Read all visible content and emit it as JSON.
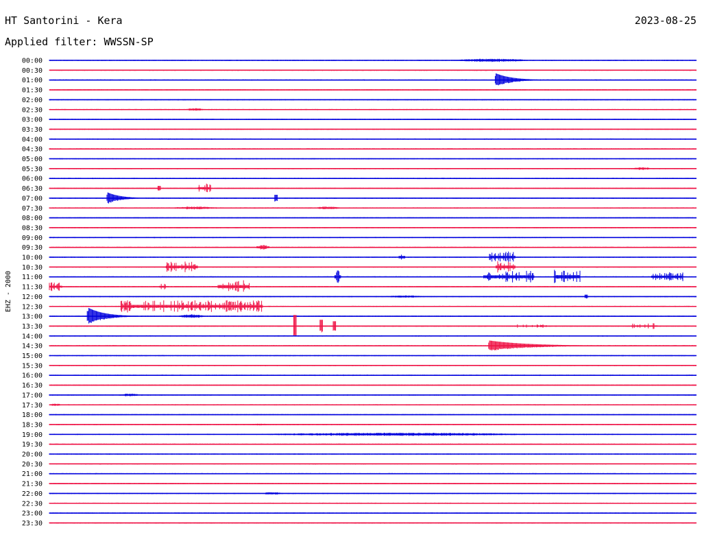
{
  "header": {
    "station": "HT Santorini - Kera",
    "date": "2023-08-25",
    "filter": "Applied filter: WWSSN-SP"
  },
  "chart_data": {
    "type": "line",
    "kind": "helicorder",
    "channel_label": "EHZ - 2000",
    "colors": {
      "odd_rows": "#0000dd",
      "even_rows": "#ee1144"
    },
    "rows": [
      "00:00",
      "00:30",
      "01:00",
      "01:30",
      "02:00",
      "02:30",
      "03:00",
      "03:30",
      "04:00",
      "04:30",
      "05:00",
      "05:30",
      "06:00",
      "06:30",
      "07:00",
      "07:30",
      "08:00",
      "08:30",
      "09:00",
      "09:30",
      "10:00",
      "10:30",
      "11:00",
      "11:30",
      "12:00",
      "12:30",
      "13:00",
      "13:30",
      "14:00",
      "14:30",
      "15:00",
      "15:30",
      "16:00",
      "16:30",
      "17:00",
      "17:30",
      "18:00",
      "18:30",
      "19:00",
      "19:30",
      "20:00",
      "20:30",
      "21:00",
      "21:30",
      "22:00",
      "22:30",
      "23:00",
      "23:30"
    ],
    "events": [
      {
        "row": 0,
        "t": 0.63,
        "amp": 0.35,
        "dur": 0.11,
        "kind": "burst"
      },
      {
        "row": 2,
        "t": 0.69,
        "amp": 1.4,
        "dur": 0.025,
        "kind": "quake"
      },
      {
        "row": 5,
        "t": 0.21,
        "amp": 0.3,
        "dur": 0.03,
        "kind": "burst"
      },
      {
        "row": 11,
        "t": 0.9,
        "amp": 0.3,
        "dur": 0.03,
        "kind": "burst"
      },
      {
        "row": 13,
        "t": 0.17,
        "amp": 0.5,
        "dur": 0.003,
        "kind": "spike"
      },
      {
        "row": 13,
        "t": 0.23,
        "amp": 1.0,
        "dur": 0.02,
        "kind": "cluster"
      },
      {
        "row": 14,
        "t": 0.09,
        "amp": 1.2,
        "dur": 0.02,
        "kind": "quake"
      },
      {
        "row": 14,
        "t": 0.35,
        "amp": 0.7,
        "dur": 0.003,
        "kind": "spike"
      },
      {
        "row": 15,
        "t": 0.19,
        "amp": 0.3,
        "dur": 0.07,
        "kind": "burst"
      },
      {
        "row": 15,
        "t": 0.41,
        "amp": 0.3,
        "dur": 0.04,
        "kind": "burst"
      },
      {
        "row": 19,
        "t": 0.32,
        "amp": 0.5,
        "dur": 0.02,
        "kind": "burst"
      },
      {
        "row": 20,
        "t": 0.54,
        "amp": 1.1,
        "dur": 0.01,
        "kind": "cluster"
      },
      {
        "row": 20,
        "t": 0.68,
        "amp": 1.2,
        "dur": 0.04,
        "kind": "cluster"
      },
      {
        "row": 21,
        "t": 0.18,
        "amp": 1.2,
        "dur": 0.05,
        "kind": "cluster"
      },
      {
        "row": 21,
        "t": 0.69,
        "amp": 1.3,
        "dur": 0.03,
        "kind": "cluster"
      },
      {
        "row": 22,
        "t": 0.44,
        "amp": 1.4,
        "dur": 0.01,
        "kind": "cluster"
      },
      {
        "row": 22,
        "t": 0.67,
        "amp": 1.3,
        "dur": 0.08,
        "kind": "cluster"
      },
      {
        "row": 22,
        "t": 0.78,
        "amp": 1.5,
        "dur": 0.04,
        "kind": "cluster"
      },
      {
        "row": 22,
        "t": 0.93,
        "amp": 1.0,
        "dur": 0.05,
        "kind": "cluster"
      },
      {
        "row": 23,
        "t": 0.0,
        "amp": 0.9,
        "dur": 0.02,
        "kind": "cluster"
      },
      {
        "row": 23,
        "t": 0.17,
        "amp": 0.8,
        "dur": 0.01,
        "kind": "cluster"
      },
      {
        "row": 23,
        "t": 0.26,
        "amp": 1.4,
        "dur": 0.05,
        "kind": "cluster"
      },
      {
        "row": 24,
        "t": 0.52,
        "amp": 0.25,
        "dur": 0.06,
        "kind": "burst"
      },
      {
        "row": 24,
        "t": 0.83,
        "amp": 0.4,
        "dur": 0.003,
        "kind": "spike"
      },
      {
        "row": 25,
        "t": 0.11,
        "amp": 1.3,
        "dur": 0.22,
        "kind": "cluster"
      },
      {
        "row": 25,
        "t": 0.27,
        "amp": 1.3,
        "dur": 0.06,
        "kind": "cluster"
      },
      {
        "row": 26,
        "t": 0.06,
        "amp": 1.8,
        "dur": 0.025,
        "kind": "quake"
      },
      {
        "row": 26,
        "t": 0.2,
        "amp": 0.4,
        "dur": 0.04,
        "kind": "burst"
      },
      {
        "row": 27,
        "t": 0.38,
        "amp": 2.3,
        "dur": 0.003,
        "kind": "spike"
      },
      {
        "row": 27,
        "t": 0.42,
        "amp": 1.3,
        "dur": 0.003,
        "kind": "spike"
      },
      {
        "row": 27,
        "t": 0.44,
        "amp": 1.0,
        "dur": 0.003,
        "kind": "spike"
      },
      {
        "row": 27,
        "t": 0.72,
        "amp": 0.4,
        "dur": 0.05,
        "kind": "cluster"
      },
      {
        "row": 27,
        "t": 0.9,
        "amp": 0.6,
        "dur": 0.04,
        "kind": "cluster"
      },
      {
        "row": 29,
        "t": 0.68,
        "amp": 1.1,
        "dur": 0.06,
        "kind": "quake"
      },
      {
        "row": 34,
        "t": 0.11,
        "amp": 0.3,
        "dur": 0.03,
        "kind": "burst"
      },
      {
        "row": 35,
        "t": 0.0,
        "amp": 0.25,
        "dur": 0.02,
        "kind": "burst"
      },
      {
        "row": 37,
        "t": 0.31,
        "amp": 0.2,
        "dur": 0.03,
        "kind": "burst"
      },
      {
        "row": 38,
        "t": 0.34,
        "amp": 0.35,
        "dur": 0.4,
        "kind": "burst"
      },
      {
        "row": 44,
        "t": 0.33,
        "amp": 0.3,
        "dur": 0.03,
        "kind": "burst"
      }
    ]
  }
}
